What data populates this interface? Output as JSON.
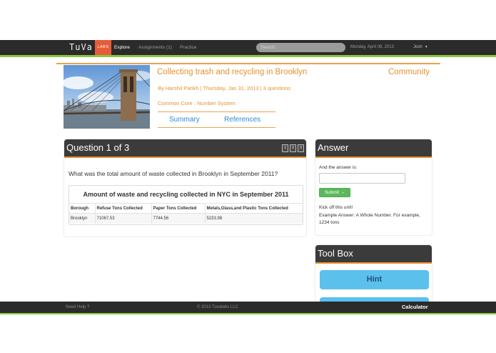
{
  "nav": {
    "logo": "TuVa",
    "labs_badge": "LABS",
    "items": [
      {
        "label": "Explore",
        "active": true
      },
      {
        "label": "Assignments (1)",
        "active": false
      },
      {
        "label": "Practice",
        "active": false
      }
    ],
    "search_placeholder": "Search",
    "date": "Monday, April 08, 2013",
    "user": "Josh"
  },
  "lesson": {
    "title": "Collecting trash and recycling in Brooklyn",
    "community_link": "Community",
    "author": "By Harshil Parikh",
    "date": "Thursday, Jan 31, 2013",
    "question_count": "3 questions",
    "byline_separator": "|",
    "standard": "Common Core : Number System",
    "tabs": [
      "Summary",
      "References"
    ]
  },
  "question_panel": {
    "title": "Question 1 of 3",
    "pager": [
      "1",
      "2",
      "3"
    ],
    "question": "What was the total amount of waste collected in Brooklyn in September 2011?",
    "table": {
      "title": "Amount of waste and recycling collected in NYC in September 2011",
      "headers": [
        "Borough",
        "Refuse Tons Collected",
        "Paper Tons Collected",
        "Metals,Glass,and Plastic Tons Collected"
      ],
      "rows": [
        [
          "Brooklyn",
          "71067.53",
          "7744.56",
          "5233.98"
        ]
      ]
    }
  },
  "answer_panel": {
    "title": "Answer",
    "label": "And the answer is:",
    "input_value": "",
    "submit_label": "Submit →",
    "kick_off": "Kick off this unit!",
    "example": "Example Answer: A Whole Number. For example, 1234 tons"
  },
  "toolbox_panel": {
    "title": "Tool Box",
    "hint_label": "Hint"
  },
  "footer": {
    "help": "Need Help ?",
    "copyright": "© 2013 Tuvalabs LLC",
    "calculator": "Calculator"
  },
  "colors": {
    "accent_orange": "#e8912e",
    "accent_green": "#8dc63f",
    "link_blue": "#2d8ccf",
    "nav_dark": "#2b2b2b",
    "labs_red": "#e65c3a"
  }
}
